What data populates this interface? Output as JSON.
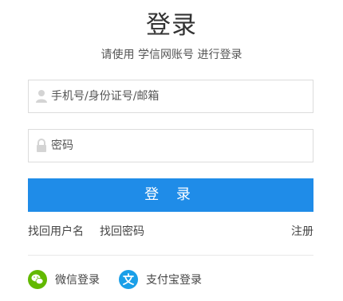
{
  "header": {
    "title": "登录",
    "subtitle": "请使用 学信网账号 进行登录"
  },
  "form": {
    "username_placeholder": "手机号/身份证号/邮箱",
    "password_placeholder": "密码",
    "login_label": "登 录"
  },
  "links": {
    "forgot_username": "找回用户名",
    "forgot_password": "找回密码",
    "register": "注册"
  },
  "social": {
    "wechat_label": "微信登录",
    "alipay_label": "支付宝登录"
  },
  "colors": {
    "primary": "#1f8ce8",
    "wechat": "#62b900",
    "alipay": "#1a9fe8"
  }
}
